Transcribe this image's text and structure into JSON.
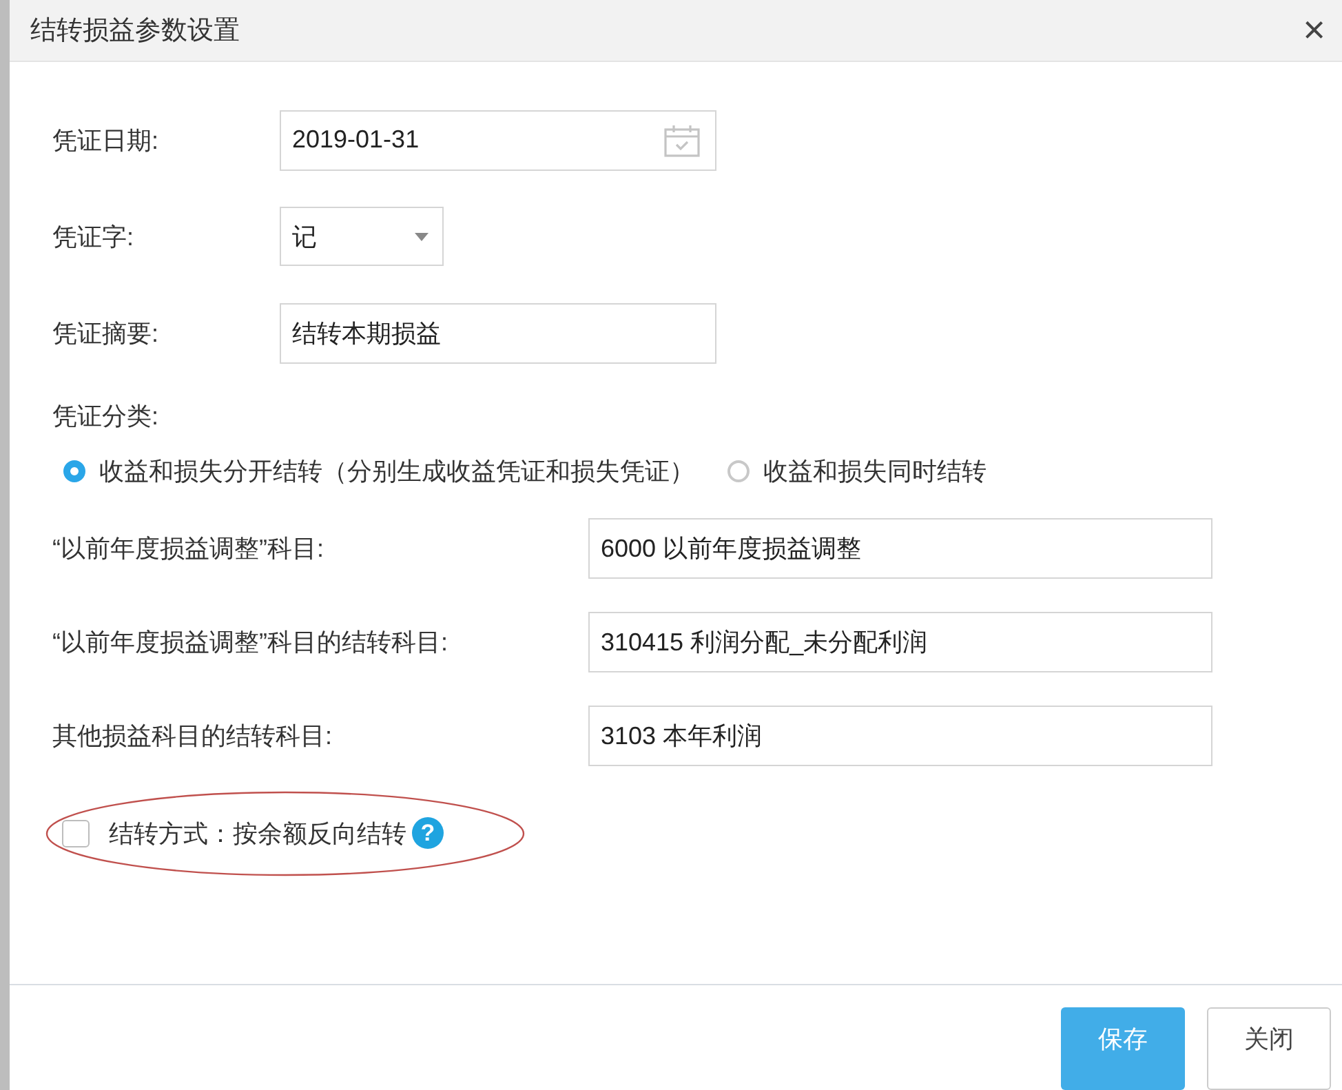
{
  "window": {
    "title": "结转损益参数设置",
    "close": "×"
  },
  "fields": [
    {
      "label": "凭证日期:",
      "kind": "date",
      "value": "2019-01-31"
    },
    {
      "label": "凭证字:",
      "kind": "select",
      "value": "记"
    },
    {
      "label": "凭证摘要:",
      "kind": "text",
      "value": "结转本期损益"
    }
  ],
  "category": {
    "label": "凭证分类:",
    "options": [
      {
        "label": "收益和损失分开结转（分别生成收益凭证和损失凭证）",
        "selected": true
      },
      {
        "label": "收益和损失同时结转",
        "selected": false
      }
    ]
  },
  "accounts": [
    {
      "label": "“以前年度损益调整”科目:",
      "value": "6000 以前年度损益调整"
    },
    {
      "label": "“以前年度损益调整”科目的结转科目:",
      "value": "310415 利润分配_未分配利润"
    },
    {
      "label": "其他损益科目的结转科目:",
      "value": "3103 本年利润"
    }
  ],
  "option": {
    "label": "结转方式：按余额反向结转",
    "checked": false,
    "help": "?",
    "circled": true
  },
  "buttons": [
    {
      "label": "保存",
      "kind": "primary"
    },
    {
      "label": "关闭",
      "kind": "default"
    }
  ]
}
